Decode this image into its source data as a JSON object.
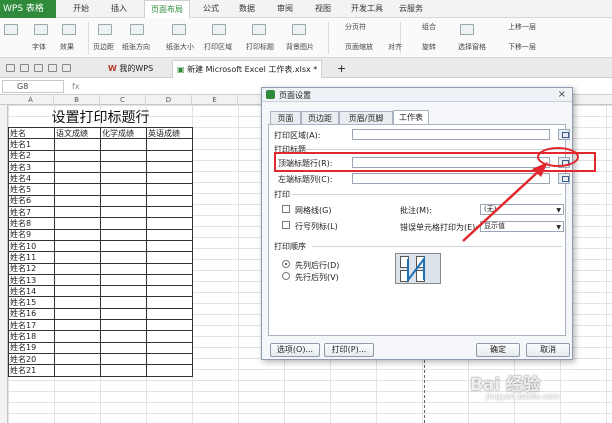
{
  "menubar": {
    "app": "WPS 表格",
    "tabs": [
      "开始",
      "插入",
      "页面布局",
      "公式",
      "数据",
      "审阅",
      "视图",
      "开发工具",
      "云服务"
    ]
  },
  "ribbon": {
    "items": [
      "字体",
      "效果",
      "页边距",
      "纸张方向",
      "纸张大小",
      "打印区域",
      "打印标题",
      "背景图片",
      "分页符",
      "页面缩放",
      "组合",
      "对齐",
      "旋转",
      "选择窗格",
      "上移一层",
      "下移一层"
    ]
  },
  "doctabs": {
    "my_wps": "我的WPS",
    "file": "新建 Microsoft Excel 工作表.xlsx *",
    "add": "+"
  },
  "formula_bar": {
    "cell_ref": "G8",
    "fx": "fx"
  },
  "sheet": {
    "columns": [
      "A",
      "B",
      "C",
      "D",
      "E"
    ],
    "title": "设置打印标题行",
    "headers": [
      "姓名",
      "语文成绩",
      "化学成绩",
      "英语成绩"
    ],
    "names": [
      "姓名1",
      "姓名2",
      "姓名3",
      "姓名4",
      "姓名5",
      "姓名6",
      "姓名7",
      "姓名8",
      "姓名9",
      "姓名10",
      "姓名11",
      "姓名12",
      "姓名13",
      "姓名14",
      "姓名15",
      "姓名16",
      "姓名17",
      "姓名18",
      "姓名19",
      "姓名20",
      "姓名21"
    ]
  },
  "dialog": {
    "title": "页面设置",
    "close": "×",
    "tabs": [
      "页面",
      "页边距",
      "页眉/页脚",
      "工作表"
    ],
    "active_tab": "工作表",
    "print_area_label": "打印区域(A):",
    "print_titles_label": "打印标题",
    "top_rows_label": "顶端标题行(R):",
    "left_cols_label": "左端标题列(C):",
    "print_label": "打印",
    "gridlines_label": "网格线(G)",
    "row_col_label": "行号列标(L)",
    "comments_label": "批注(M):",
    "comments_value": "(无)",
    "errors_label": "错误单元格打印为(E):",
    "errors_value": "显示值",
    "order_label": "打印顺序",
    "order_down": "先列后行(D)",
    "order_over": "先行后列(V)",
    "options_btn": "选项(O)...",
    "print_btn": "打印(P)...",
    "ok_btn": "确定",
    "cancel_btn": "取消"
  },
  "watermark": {
    "brand": "Bai 经验",
    "url": "jingyan.baidu.com"
  },
  "colors": {
    "accent": "#2f8b3b",
    "annotation": "#e0282e"
  }
}
